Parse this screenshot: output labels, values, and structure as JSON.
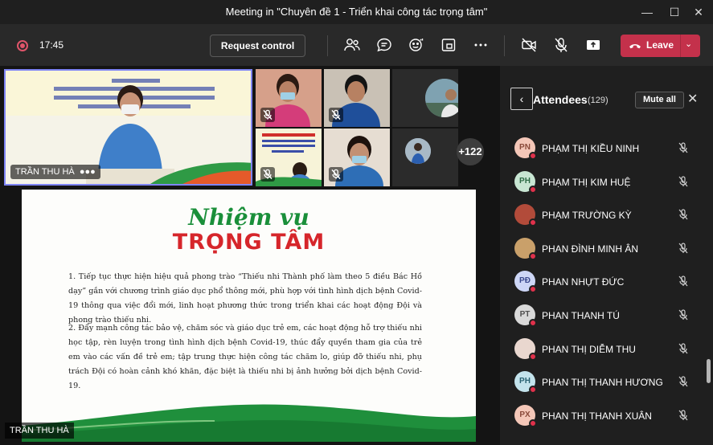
{
  "window": {
    "title": "Meeting in \"Chuyên đề 1 - Triển khai công tác trọng tâm\"",
    "minimize_icon": "minimize-icon",
    "maximize_icon": "maximize-icon",
    "close_icon": "close-icon"
  },
  "toolbar": {
    "time": "17:45",
    "request_control": "Request control",
    "leave": "Leave",
    "icons": [
      "people-icon",
      "chat-icon",
      "reactions-icon",
      "share-tray-icon",
      "more-icon",
      "camera-off-icon",
      "mic-off-icon",
      "share-screen-icon"
    ]
  },
  "stage": {
    "main_speaker_name": "TRẦN THU HÀ",
    "more_count": "+122",
    "presenter_name": "TRẦN THU HÀ"
  },
  "slide": {
    "title_line1": "Nhiệm vụ",
    "title_line2": "TRỌNG TÂM",
    "paragraph1": "1. Tiếp tục thực hiện hiệu quả phong trào “Thiếu nhi Thành phố làm theo 5 điều Bác Hồ dạy” gắn với chương trình giáo dục phổ thông mới, phù hợp với tình hình dịch bệnh Covid-19 thông qua việc đổi mới, linh hoạt phương thức trong triển khai các hoạt động Đội và phong trào thiếu nhi.",
    "paragraph2": "2. Đẩy mạnh công tác bảo vệ, chăm sóc và giáo dục trẻ em, các hoạt động hỗ trợ thiếu nhi học tập, rèn luyện trong tình hình dịch bệnh Covid-19, thúc đẩy quyền tham gia của trẻ em vào các vấn đề trẻ em; tập trung thực hiện công tác chăm lo, giúp đỡ thiếu nhi, phụ trách Đội có hoàn cảnh khó khăn, đặc biệt là thiếu nhi bị ảnh hưởng bởi dịch bệnh Covid-19."
  },
  "attendees": {
    "title": "Attendees",
    "count": "(129)",
    "mute_all": "Mute all",
    "list": [
      {
        "initials": "PN",
        "name": "PHẠM THỊ KIỀU NINH",
        "color": "#f4c7b8",
        "text": "#8a4a3a"
      },
      {
        "initials": "PH",
        "name": "PHẠM THỊ KIM HUỆ",
        "color": "#c8e6d3",
        "text": "#2e6b46"
      },
      {
        "initials": "",
        "name": "PHẠM TRƯỜNG KỲ",
        "color": "#b24b3a",
        "text": "#ffffff"
      },
      {
        "initials": "",
        "name": "PHAN ĐÌNH MINH ÂN",
        "color": "#c9a06a",
        "text": "#ffffff"
      },
      {
        "initials": "PĐ",
        "name": "PHAN NHỰT ĐỨC",
        "color": "#cdd6f6",
        "text": "#3c4a8e"
      },
      {
        "initials": "PT",
        "name": "PHAN THANH TÚ",
        "color": "#d9d9d9",
        "text": "#505050"
      },
      {
        "initials": "",
        "name": "PHAN THỊ DIỄM THU",
        "color": "#e9d7cf",
        "text": "#ffffff"
      },
      {
        "initials": "PH",
        "name": "PHAN THỊ THANH HƯƠNG",
        "color": "#c3e3ec",
        "text": "#2a6272"
      },
      {
        "initials": "PX",
        "name": "PHAN THỊ THANH XUÂN",
        "color": "#f4c7b8",
        "text": "#8a4a3a"
      }
    ]
  },
  "colors": {
    "accent": "#7f85f5",
    "leave": "#c4314b",
    "slide_green": "#1a8f3a",
    "slide_red": "#d6262b"
  }
}
